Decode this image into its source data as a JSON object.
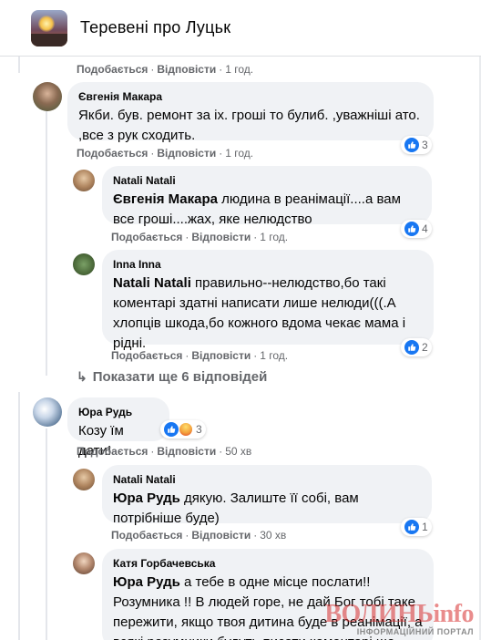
{
  "header": {
    "group_name": "Теревені про Луцьк"
  },
  "labels": {
    "like": "Подобається",
    "reply": "Відповісти",
    "dot": "·"
  },
  "comments": [
    {
      "time": "1 год."
    },
    {
      "author": "Євгенія Макара",
      "text": "Якби. був. ремонт за іх. гроші то булиб. ,уважніші ато. ,все з рук сходить.",
      "time": "1 год.",
      "likes": "3"
    },
    {
      "author": "Natali Natali",
      "mention": "Євгенія Макара",
      "text": " людина в реанімації....а вам все гроші....жах, яке нелюдство",
      "time": "1 год.",
      "likes": "4"
    },
    {
      "author": "Inna Inna",
      "mention": "Natali Natali",
      "text": " правильно--нелюдство,бо такі коментарі здатні написати лише нелюди(((.А хлопців шкода,бо кожного вдома чекає мама і рідні.",
      "time": "1 год.",
      "likes": "2"
    },
    {
      "author": "Юра Рудь",
      "text": "Козу їм дати!",
      "time": "50 хв",
      "likes": "3"
    },
    {
      "author": "Natali Natali",
      "mention": "Юра Рудь",
      "text": " дякую. Залиште її собі, вам потрібніше буде)",
      "time": "30 хв",
      "likes": "1"
    },
    {
      "author": "Катя Горбачевська",
      "mention": "Юра Рудь",
      "text": " а тебе в одне місце послати!! Розумника !! В людей горе, не дай Бог тобі таке пережити, якщо твоя дитина буде в реанімації, а всякі розумники будуть писати коментарі що"
    }
  ],
  "more_replies": "Показати ще 6 відповідей",
  "watermark": {
    "main": "ВОЛИНЬinfo",
    "sub": "ІНФОРМАЦІЙНИЙ ПОРТАЛ"
  },
  "colors": {
    "bubble": "#f0f2f5",
    "like_blue": "#1877f2",
    "meta_gray": "#65676b"
  }
}
